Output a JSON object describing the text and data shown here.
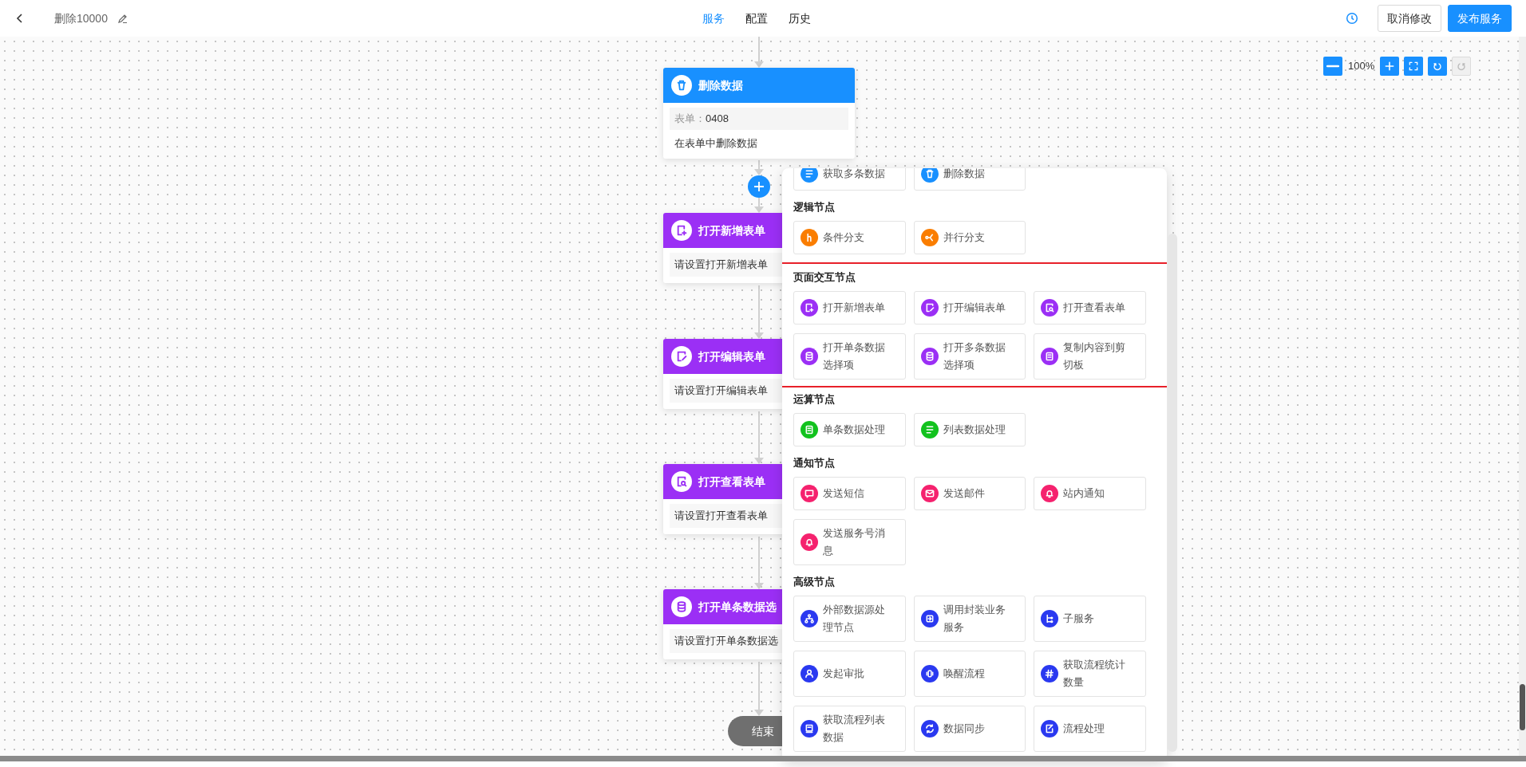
{
  "header": {
    "title": "删除10000",
    "tabs": [
      {
        "label": "服务",
        "selected": true
      },
      {
        "label": "配置",
        "selected": false
      },
      {
        "label": "历史",
        "selected": false
      }
    ],
    "buttons": [
      {
        "label": "取消修改",
        "kind": "default"
      },
      {
        "label": "发布服务",
        "kind": "primary"
      }
    ]
  },
  "zoom": {
    "value": "100%",
    "controls": [
      {
        "kind": "zoom_out",
        "disabled": false
      },
      {
        "kind": "zoom_in",
        "disabled": false
      },
      {
        "kind": "fit",
        "disabled": false
      },
      {
        "kind": "undo",
        "disabled": false
      },
      {
        "kind": "redo",
        "disabled": true
      }
    ]
  },
  "flow": {
    "nodes": [
      {
        "kind": "trash",
        "title": "删除数据",
        "color": "#1890ff",
        "field_label": "表单：",
        "field_value": "0408",
        "description": "在表单中删除数据"
      },
      {
        "kind": "form_add",
        "title": "打开新增表单",
        "color": "#9b2ff5",
        "hint": "请设置打开新增表单"
      },
      {
        "kind": "form_edit",
        "title": "打开编辑表单",
        "color": "#9b2ff5",
        "hint": "请设置打开编辑表单"
      },
      {
        "kind": "form_view",
        "title": "打开查看表单",
        "color": "#9b2ff5",
        "hint": "请设置打开查看表单"
      },
      {
        "kind": "database",
        "title": "打开单条数据选",
        "color": "#9b2ff5",
        "hint": "请设置打开单条数据选"
      }
    ],
    "end": "结束"
  },
  "palette": {
    "sections": [
      {
        "color": "#1890ff",
        "highlighted": false,
        "items": [
          {
            "label": "获取多条数据",
            "kind": "list"
          },
          {
            "label": "删除数据",
            "kind": "trash"
          }
        ]
      },
      {
        "title": "逻辑节点",
        "color": "#fa7d00",
        "highlighted": false,
        "items": [
          {
            "label": "条件分支",
            "kind": "branch"
          },
          {
            "label": "并行分支",
            "kind": "fork"
          }
        ]
      },
      {
        "title": "页面交互节点",
        "color": "#9b2ff5",
        "highlighted": true,
        "items": [
          {
            "label": "打开新增表单",
            "kind": "form_add"
          },
          {
            "label": "打开编辑表单",
            "kind": "form_edit"
          },
          {
            "label": "打开查看表单",
            "kind": "form_view"
          },
          {
            "label": "打开单条数据选择项",
            "kind": "database"
          },
          {
            "label": "打开多条数据选择项",
            "kind": "database"
          },
          {
            "label": "复制内容到剪切板",
            "kind": "document"
          }
        ]
      },
      {
        "title": "运算节点",
        "color": "#12c21e",
        "highlighted": false,
        "items": [
          {
            "label": "单条数据处理",
            "kind": "document"
          },
          {
            "label": "列表数据处理",
            "kind": "list"
          }
        ]
      },
      {
        "title": "通知节点",
        "color": "#f5226e",
        "highlighted": false,
        "items": [
          {
            "label": "发送短信",
            "kind": "chat"
          },
          {
            "label": "发送邮件",
            "kind": "mail"
          },
          {
            "label": "站内通知",
            "kind": "bell"
          },
          {
            "label": "发送服务号消息",
            "kind": "bell"
          }
        ]
      },
      {
        "title": "高级节点",
        "color": "#2a39f0",
        "highlighted": false,
        "items": [
          {
            "label": "外部数据源处理节点",
            "kind": "hierarchy"
          },
          {
            "label": "调用封装业务服务",
            "kind": "swap"
          },
          {
            "label": "子服务",
            "kind": "tree"
          },
          {
            "label": "发起审批",
            "kind": "user"
          },
          {
            "label": "唤醒流程",
            "kind": "vibrate"
          },
          {
            "label": "获取流程统计数量",
            "kind": "hash"
          },
          {
            "label": "获取流程列表数据",
            "kind": "book"
          },
          {
            "label": "数据同步",
            "kind": "sync"
          },
          {
            "label": "流程处理",
            "kind": "note"
          }
        ]
      }
    ]
  }
}
